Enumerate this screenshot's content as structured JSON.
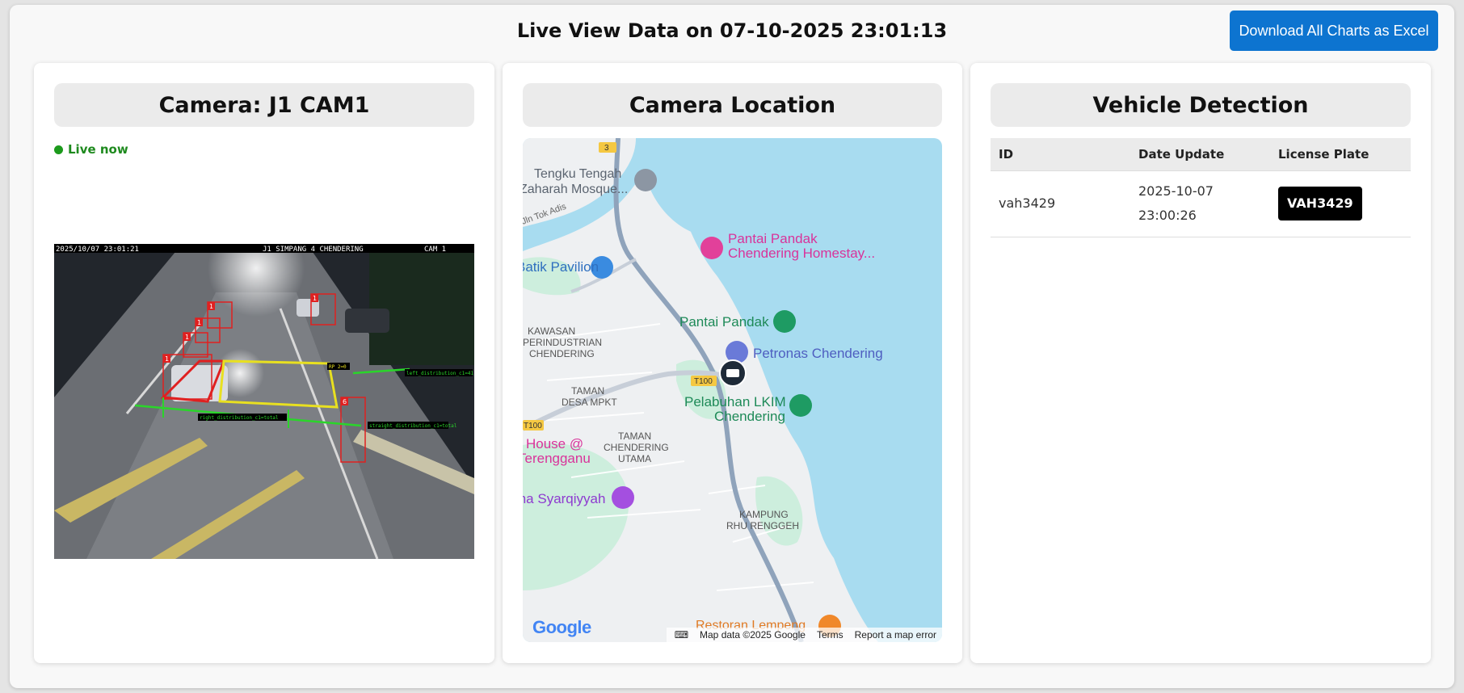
{
  "header": {
    "title": "Live View Data on 07-10-2025 23:01:13",
    "download_label": "Download All Charts as Excel"
  },
  "camera_panel": {
    "title": "Camera: J1 CAM1",
    "status": "Live now",
    "overlay": {
      "timestamp": "2025/10/07 23:01:21",
      "location": "J1 SIMPANG 4 CHENDERING",
      "cam": "CAM 1",
      "labels": [
        "left_distribution_c1=41",
        "straight_distribution_c1=total",
        "right_distribution_c1=total",
        "RP 2=0",
        "1",
        "1",
        "1",
        "1",
        "1",
        "6"
      ]
    }
  },
  "map_panel": {
    "title": "Camera Location",
    "places": [
      "Tengku Tengah",
      "Zaharah Mosque...",
      "Jln Tok Adis",
      "Pantai Pandak",
      "Chendering Homestay...",
      "Batik Pavilion",
      "Pantai Pandak",
      "Petronas Chendering",
      "KAWASAN",
      "PERINDUSTRIAN",
      "CHENDERING",
      "TAMAN",
      "DESA MPKT",
      "Pelabuhan LKIM",
      "Chendering",
      "TAMAN",
      "CHENDERING",
      "UTAMA",
      "House @",
      "Terengganu",
      "Ina Syarqiyyah",
      "KAMPUNG",
      "RHU RENGGEH",
      "Restoran Lempeng"
    ],
    "road_labels": [
      "3",
      "T100",
      "T100"
    ],
    "google": "Google",
    "map_data": "Map data ©2025 Google",
    "terms": "Terms",
    "report": "Report a map error"
  },
  "vehicle_panel": {
    "title": "Vehicle Detection",
    "columns": [
      "ID",
      "Date Update",
      "License Plate"
    ],
    "rows": [
      {
        "id": "vah3429",
        "date": "2025-10-07",
        "time": "23:00:26",
        "plate": "VAH3429"
      }
    ]
  }
}
